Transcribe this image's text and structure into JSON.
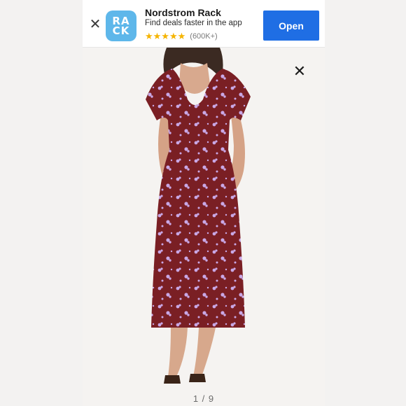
{
  "banner": {
    "close_icon": "close-icon",
    "app_icon_lines": [
      "RA",
      "CK"
    ],
    "app_name": "Nordstrom Rack",
    "subtitle": "Find deals faster in the app",
    "stars": "★★★★★",
    "rating_count": "(600K+)",
    "open_label": "Open",
    "colors": {
      "button": "#1f6ee4",
      "icon_bg": "#5eb7ea",
      "stars": "#f5b400"
    }
  },
  "gallery": {
    "close_icon": "close-icon",
    "page_indicator": "1 / 9",
    "product_image": "woman wearing burgundy floral midi dress with flutter sleeves",
    "colors": {
      "dress": "#7a1f24",
      "print": "#c9a8e6"
    }
  }
}
